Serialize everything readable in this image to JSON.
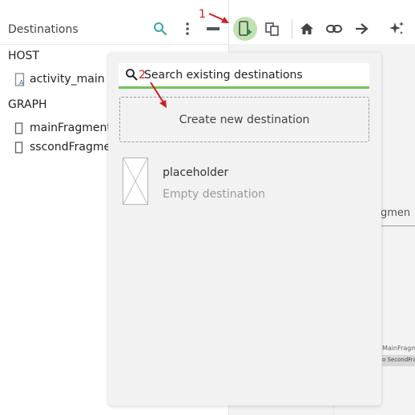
{
  "left_panel": {
    "title": "Destinations",
    "host_label": "HOST",
    "host_items": [
      {
        "label": "activity_main ("
      }
    ],
    "graph_label": "GRAPH",
    "graph_items": [
      {
        "label": "mainFragment"
      },
      {
        "label": "sscondFragme"
      }
    ]
  },
  "toolbar": {
    "icons": [
      "search-icon",
      "more-vert-icon",
      "collapse-icon",
      "new-destination-icon",
      "nested-graph-icon",
      "home-icon",
      "link-icon",
      "arrow-right-icon",
      "auto-arrange-icon"
    ]
  },
  "popup": {
    "search_placeholder": "Search existing destinations",
    "create_label": "Create new destination",
    "destination": {
      "name": "placeholder",
      "description": "Empty destination"
    }
  },
  "canvas": {
    "tab_label": "agmen",
    "node_title": "MainFragme",
    "node_text": "o SecondFragm"
  },
  "annotations": {
    "step1": "1",
    "step2": "2"
  },
  "colors": {
    "accent_green": "#73c25c",
    "button_green": "#bfe3b0",
    "annotation_red": "#d61c1c",
    "search_teal": "#3fa7a0"
  }
}
